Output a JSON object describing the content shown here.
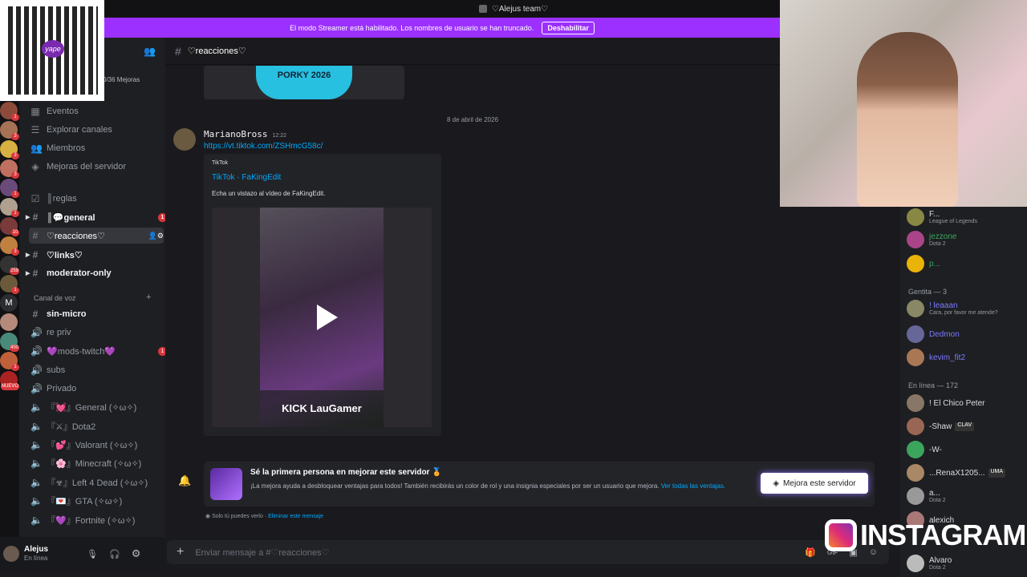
{
  "topbar": {
    "title": "♡Alejus team♡"
  },
  "streamer": {
    "text": "El modo Streamer está habilitado. Los nombres de usuario se han truncado.",
    "button": "Deshabilitar"
  },
  "server_header": {
    "boosts": "0/36 Mejoras"
  },
  "sidebar": {
    "items": [
      {
        "label": "Eventos"
      },
      {
        "label": "Explorar canales"
      },
      {
        "label": "Miembros"
      },
      {
        "label": "Mejoras del servidor"
      }
    ],
    "channels": [
      {
        "label": "║reglas"
      },
      {
        "label": "║💬general",
        "badge": "1"
      },
      {
        "label": "♡reacciones♡"
      },
      {
        "label": "♡links♡"
      },
      {
        "label": "moderator-only"
      }
    ],
    "voice_category": "Canal de voz",
    "voice": [
      {
        "label": "sin-micro"
      },
      {
        "label": "re priv"
      },
      {
        "label": "💜mods-twitch💜",
        "badge": "1"
      },
      {
        "label": "subs"
      },
      {
        "label": "Privado"
      },
      {
        "label": "『💓』General (✧ω✧)"
      },
      {
        "label": "『⚔』Dota2"
      },
      {
        "label": "『💕』Valorant (✧ω✧)"
      },
      {
        "label": "『🌸』Minecraft (✧ω✧)"
      },
      {
        "label": "『☣』Left 4 Dead (✧ω✧)"
      },
      {
        "label": "『💌』GTA (✧ω✧)"
      },
      {
        "label": "『💜』Fortnite (✧ω✧)"
      }
    ]
  },
  "servers_badges": [
    "1",
    "3",
    "3",
    "3",
    "1",
    "1",
    "10",
    "3",
    "259",
    "1",
    "400",
    "1",
    "NUEVO"
  ],
  "servers_letter": "M",
  "user": {
    "name": "Alejus",
    "status": "En línea"
  },
  "chat": {
    "channel": "♡reacciones♡",
    "date_divider": "8 de abril de 2026",
    "message": {
      "author": "MarianoBross",
      "time": "12:22",
      "link": "https://vt.tiktok.com/ZSHmcG58c/",
      "embed": {
        "provider": "TikTok",
        "title": "TikTok · FaKingEdit",
        "description": "Echa un vistazo al vídeo de FaKingEdit."
      },
      "video_overlay": "KICK LauGamer",
      "image_text": "PORKY 2026"
    },
    "boost": {
      "title": "Sé la primera persona en mejorar este servidor 🏅",
      "body": "¡La mejora ayuda a desbloquear ventajas para todos! También recibirás un color de rol y una insignia especiales por ser un usuario que mejora.",
      "link": "Ver todas las ventajas.",
      "button": "Mejora este servidor",
      "note": "Solo tú puedes verlo ·",
      "note_link": "Eliminar este mensaje"
    },
    "input_placeholder": "Enviar mensaje a #♡reacciones♡"
  },
  "members": {
    "top": [
      {
        "name": "F...",
        "sub": "League of Legends"
      },
      {
        "name": "jezzone",
        "sub": "Dota 2"
      },
      {
        "name": "p...",
        "sub": ""
      }
    ],
    "section1": "Gentita — 3",
    "g": [
      {
        "name": "! leaaan",
        "sub": "Cara, por favor me atende?"
      },
      {
        "name": "Dedmon",
        "sub": ""
      },
      {
        "name": "kevim_fit2",
        "sub": ""
      }
    ],
    "section2": "En línea — 172",
    "online": [
      {
        "name": "! El Chico Peter",
        "sub": ""
      },
      {
        "name": "-Shaw",
        "tag": "CLAV",
        "sub": ""
      },
      {
        "name": "-W-",
        "sub": ""
      },
      {
        "name": "...RenaX1205...",
        "tag": "UMA",
        "sub": ""
      },
      {
        "name": "a...",
        "sub": "Dota 2"
      },
      {
        "name": "alexich",
        "sub": ""
      },
      {
        "name": "Alvaro",
        "sub": "Dota 2"
      }
    ]
  },
  "overlay": {
    "qr_text": "yape",
    "instagram": "INSTAGRAM"
  }
}
